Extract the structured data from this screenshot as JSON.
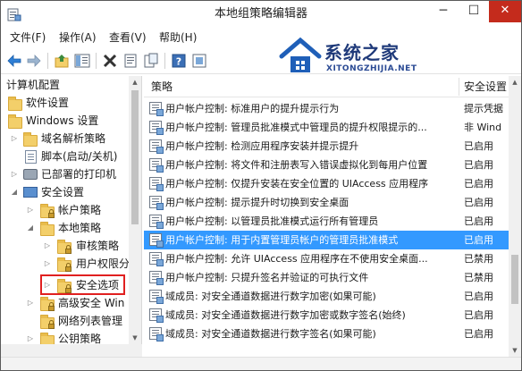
{
  "window": {
    "title": "本地组策略编辑器"
  },
  "controls": {
    "minimize": "─",
    "maximize": "☐",
    "close": "✕"
  },
  "menu": [
    "文件(F)",
    "操作(A)",
    "查看(V)",
    "帮助(H)"
  ],
  "logo": {
    "title": "系统之家",
    "subtitle": "XITONGZHIJIA.NET"
  },
  "tree": [
    {
      "label": "计算机配置",
      "depth": 0,
      "icon": "none"
    },
    {
      "label": "软件设置",
      "depth": 0,
      "icon": "folder"
    },
    {
      "label": "Windows 设置",
      "depth": 0,
      "icon": "folder"
    },
    {
      "label": "域名解析策略",
      "depth": 1,
      "icon": "folder"
    },
    {
      "label": "脚本(启动/关机)",
      "depth": 1,
      "icon": "doc"
    },
    {
      "label": "已部署的打印机",
      "depth": 1,
      "icon": "printer"
    },
    {
      "label": "安全设置",
      "depth": 1,
      "icon": "monitor"
    },
    {
      "label": "帐户策略",
      "depth": 2,
      "icon": "lockfolder"
    },
    {
      "label": "本地策略",
      "depth": 2,
      "icon": "folder"
    },
    {
      "label": "审核策略",
      "depth": 3,
      "icon": "lockfolder"
    },
    {
      "label": "用户权限分",
      "depth": 3,
      "icon": "lockfolder"
    },
    {
      "label": "安全选项",
      "depth": 3,
      "icon": "lockfolder"
    },
    {
      "label": "高级安全 Win",
      "depth": 2,
      "icon": "lockfolder"
    },
    {
      "label": "网络列表管理",
      "depth": 2,
      "icon": "lockfolder"
    },
    {
      "label": "公钥策略",
      "depth": 2,
      "icon": "lockfolder"
    }
  ],
  "columns": {
    "policy": "策略",
    "setting": "安全设置"
  },
  "rows": [
    {
      "policy": "用户帐户控制: 标准用户的提升提示行为",
      "setting": "提示凭据"
    },
    {
      "policy": "用户帐户控制: 管理员批准模式中管理员的提升权限提示的...",
      "setting": "非 Wind"
    },
    {
      "policy": "用户帐户控制: 检测应用程序安装并提示提升",
      "setting": "已启用"
    },
    {
      "policy": "用户帐户控制: 将文件和注册表写入错误虚拟化到每用户位置",
      "setting": "已启用"
    },
    {
      "policy": "用户帐户控制: 仅提升安装在安全位置的 UIAccess 应用程序",
      "setting": "已启用"
    },
    {
      "policy": "用户帐户控制: 提示提升时切换到安全桌面",
      "setting": "已启用"
    },
    {
      "policy": "用户帐户控制: 以管理员批准模式运行所有管理员",
      "setting": "已启用"
    },
    {
      "policy": "用户帐户控制: 用于内置管理员帐户的管理员批准模式",
      "setting": "已启用",
      "selected": true
    },
    {
      "policy": "用户帐户控制: 允许 UIAccess 应用程序在不使用安全桌面...",
      "setting": "已禁用"
    },
    {
      "policy": "用户帐户控制: 只提升签名并验证的可执行文件",
      "setting": "已禁用"
    },
    {
      "policy": "域成员: 对安全通道数据进行数字加密(如果可能)",
      "setting": "已启用"
    },
    {
      "policy": "域成员: 对安全通道数据进行数字加密或数字签名(始终)",
      "setting": "已启用"
    },
    {
      "policy": "域成员: 对安全通道数据进行数字签名(如果可能)",
      "setting": "已启用"
    }
  ]
}
